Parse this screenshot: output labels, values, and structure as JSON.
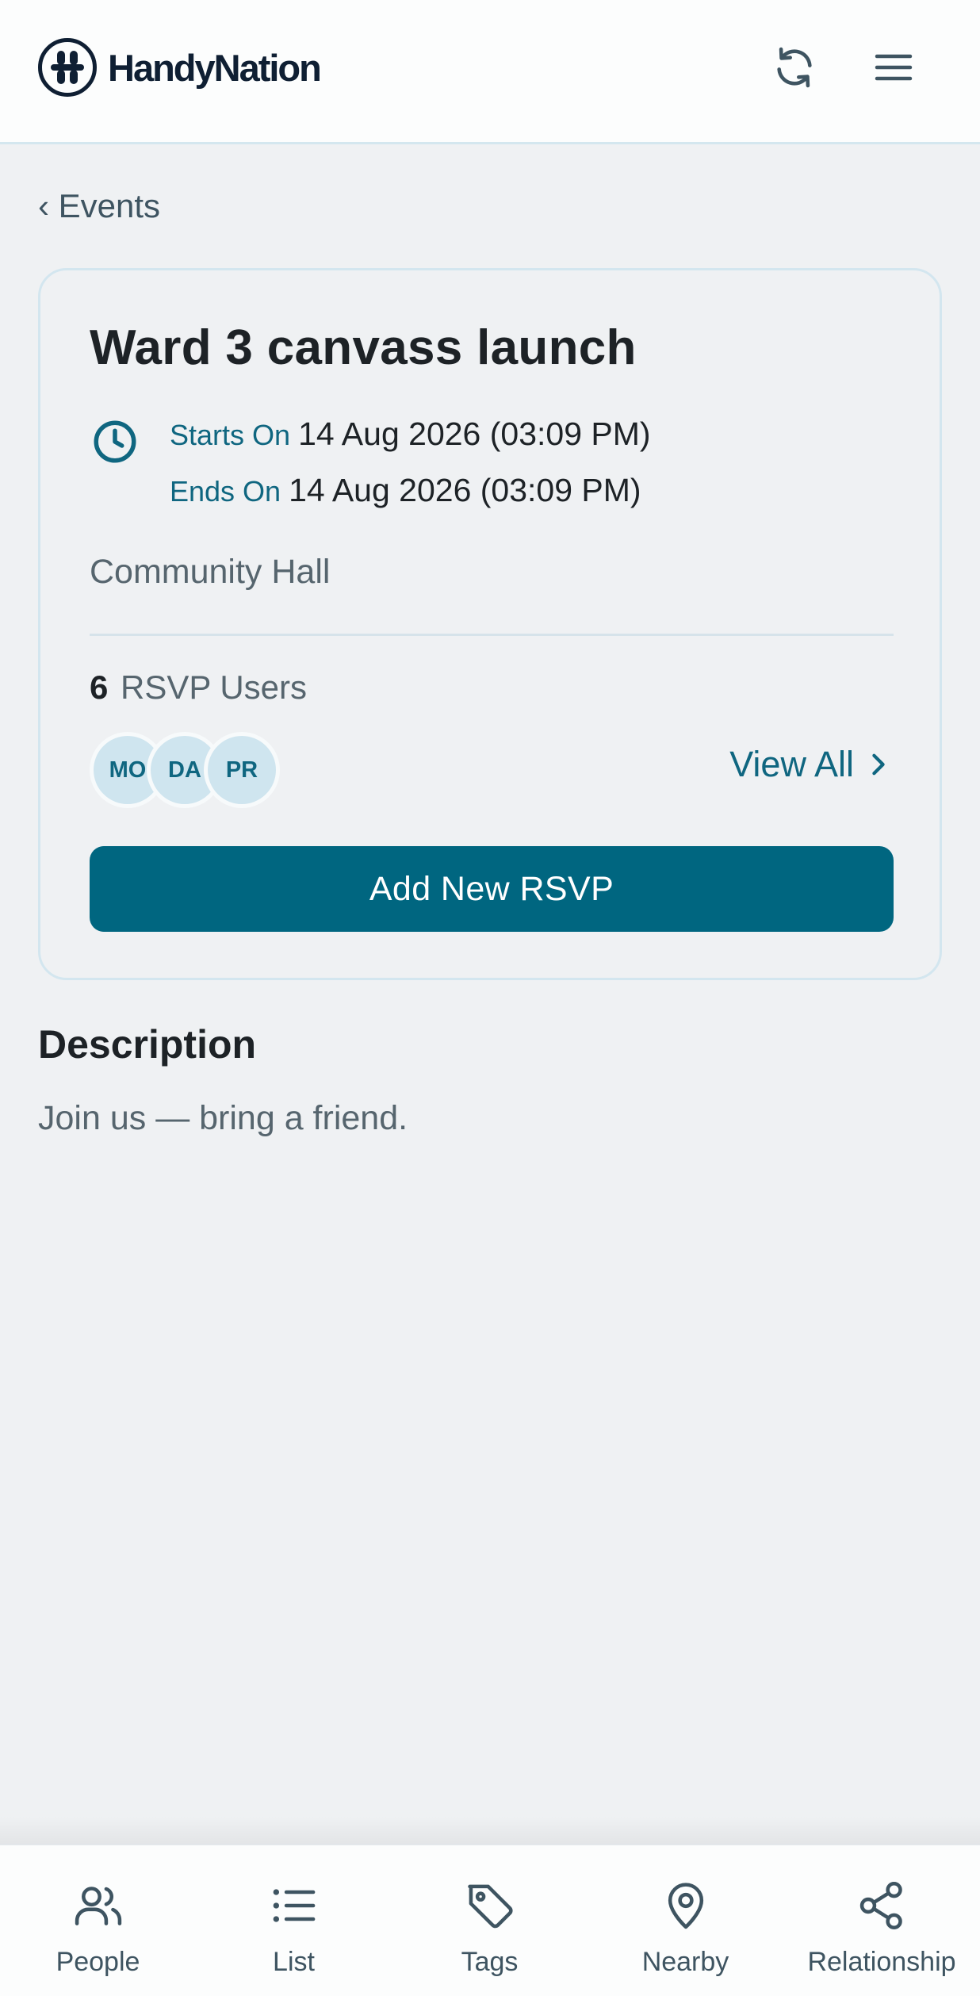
{
  "header": {
    "brand": "HandyNation",
    "icons": {
      "logo": "handynation-logo",
      "refresh": "refresh-icon",
      "menu": "hamburger-menu-icon"
    }
  },
  "nav": {
    "back_label": "‹ Events"
  },
  "event": {
    "title": "Ward 3 canvass launch",
    "starts_label": "Starts On",
    "starts_value": "14 Aug 2026 (03:09 PM)",
    "ends_label": "Ends On",
    "ends_value": "14 Aug 2026 (03:09 PM)",
    "location": "Community Hall",
    "rsvp_count": "6",
    "rsvp_label": "RSVP Users",
    "avatars": [
      "MO",
      "DA",
      "PR"
    ],
    "view_all_label": "View All",
    "add_rsvp_label": "Add New RSVP"
  },
  "description": {
    "heading": "Description",
    "text": "Join us — bring a friend."
  },
  "bottom_nav": [
    {
      "label": "People",
      "icon": "people-icon"
    },
    {
      "label": "List",
      "icon": "list-icon"
    },
    {
      "label": "Tags",
      "icon": "tag-icon"
    },
    {
      "label": "Nearby",
      "icon": "location-pin-icon"
    },
    {
      "label": "Relationship",
      "icon": "share-nodes-icon"
    }
  ],
  "colors": {
    "accent": "#006680",
    "accent_text": "#0f6680",
    "background": "#eff1f3",
    "brand_dark": "#0f1f33"
  }
}
